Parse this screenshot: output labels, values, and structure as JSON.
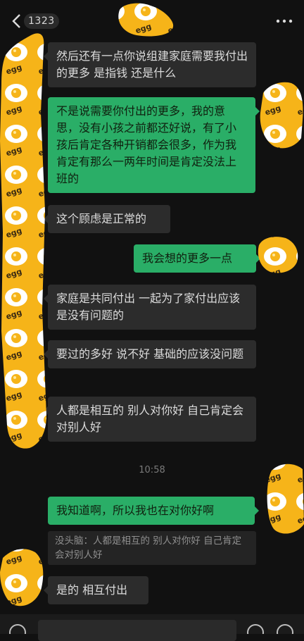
{
  "header": {
    "unread_count": "1323"
  },
  "messages": [
    {
      "side": "in",
      "text": "然后还有一点你说组建家庭需要我付出的更多 是指钱 还是什么"
    },
    {
      "side": "out",
      "text": "不是说需要你付出的更多，我的意思，没有小孩之前都还好说，有了小孩后肯定各种开销都会很多，作为我肯定有那么一两年时间是肯定没法上班的"
    },
    {
      "side": "in",
      "text": "这个顾虑是正常的"
    },
    {
      "side": "out",
      "text": "我会想的更多一点"
    },
    {
      "side": "in",
      "text": "家庭是共同付出 一起为了家付出应该是没有问题的"
    },
    {
      "side": "in",
      "text": "要过的多好 说不好 基础的应该没问题"
    },
    {
      "side": "in",
      "text": "人都是相互的 别人对你好 自己肯定会对别人好"
    },
    {
      "side": "out",
      "text": "我知道啊，所以我也在对你好啊"
    },
    {
      "side": "in",
      "text": "是的 相互付出"
    }
  ],
  "timestamp": "10:58",
  "quote": {
    "text": "没头脑：人都是相互的 别人对你好 自己肯定会对别人好"
  },
  "icons": {
    "back": "chevron-left-icon",
    "more": "more-dots-icon",
    "voice": "voice-icon",
    "emoji": "emoji-icon",
    "plus": "plus-icon",
    "sticker": "egg-sticker"
  },
  "colors": {
    "background": "#111111",
    "incoming_bubble": "#2c2c2c",
    "outgoing_bubble": "#2aae67",
    "sticker_yellow": "#f6b419"
  }
}
